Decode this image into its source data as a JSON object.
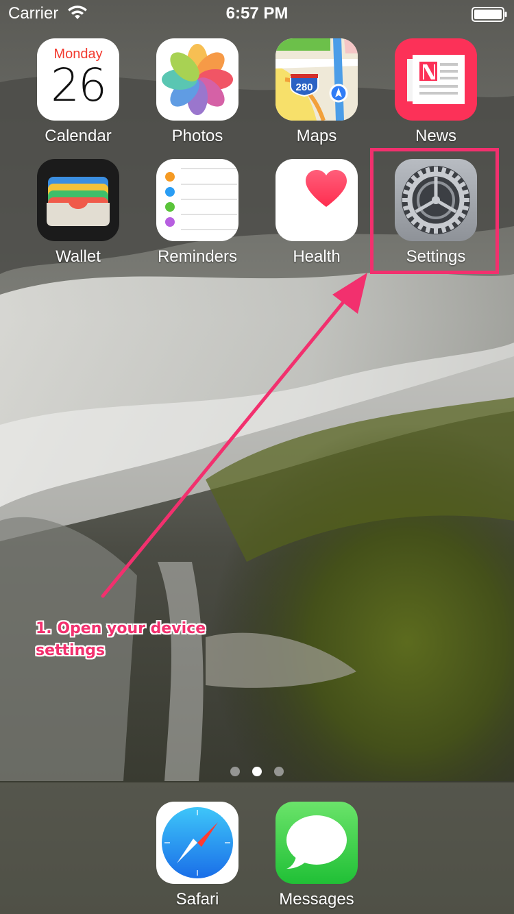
{
  "status_bar": {
    "carrier": "Carrier",
    "time": "6:57 PM",
    "wifi_icon": "wifi-icon",
    "battery_icon": "battery-icon"
  },
  "calendar_widget": {
    "day_name": "Monday",
    "date": "26"
  },
  "apps": [
    {
      "label": "Calendar",
      "icon": "calendar-icon"
    },
    {
      "label": "Photos",
      "icon": "photos-icon"
    },
    {
      "label": "Maps",
      "icon": "maps-icon",
      "badge_text": "280"
    },
    {
      "label": "News",
      "icon": "news-icon"
    },
    {
      "label": "Wallet",
      "icon": "wallet-icon"
    },
    {
      "label": "Reminders",
      "icon": "reminders-icon"
    },
    {
      "label": "Health",
      "icon": "health-icon"
    },
    {
      "label": "Settings",
      "icon": "settings-icon"
    }
  ],
  "dock_apps": [
    {
      "label": "Safari",
      "icon": "safari-icon"
    },
    {
      "label": "Messages",
      "icon": "messages-icon"
    }
  ],
  "page_indicator": {
    "pages": 3,
    "current": 2
  },
  "annotation": {
    "text": "1.  Open your device settings",
    "color": "#f2306e"
  },
  "colors": {
    "annotation_pink": "#f2306e",
    "calendar_red": "#f23b30",
    "news_red": "#fc3158",
    "messages_green": "#34c759"
  }
}
